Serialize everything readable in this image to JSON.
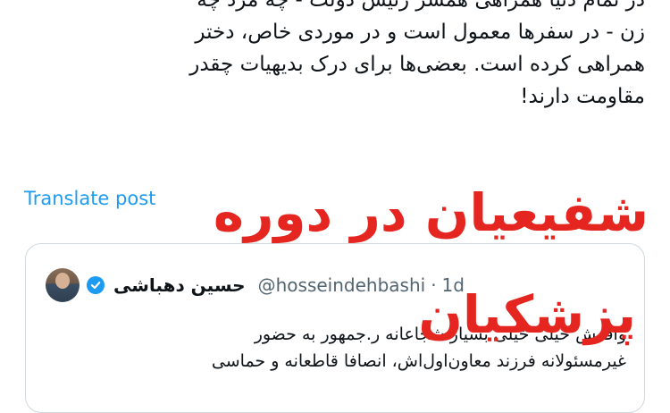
{
  "tweet": {
    "lines": [
      "در تمام دنیا همراهی همسر رئیس دولت - چه مرد چه",
      "زن - در سفرها معمول است و در موردی خاص، دختر",
      "همراهی کرده است. بعضی‌ها برای درک بدیهیات چقدر",
      "مقاومت دارند!"
    ],
    "translate_label": "Translate post"
  },
  "quote": {
    "author_name": "حسین دهباشی",
    "handle": "@hosseindehbashi",
    "separator": "·",
    "time": "1d",
    "lines": [
      "واقعش خیلی خیلی بسیار شجاعانه ر.جمهور به حضور",
      "غیرمسئولانه فرزند معاون‌اول‌اش، انصافا قاطعانه و حماسی"
    ]
  },
  "overlay": {
    "line1": "شفیعیان در دوره",
    "line2": "پزشکیان",
    "color": "#e52620"
  },
  "colors": {
    "link": "#1d9bf0",
    "muted": "#536471",
    "border": "#cfd9de"
  },
  "icons": {
    "verified": "verified-badge-icon"
  }
}
